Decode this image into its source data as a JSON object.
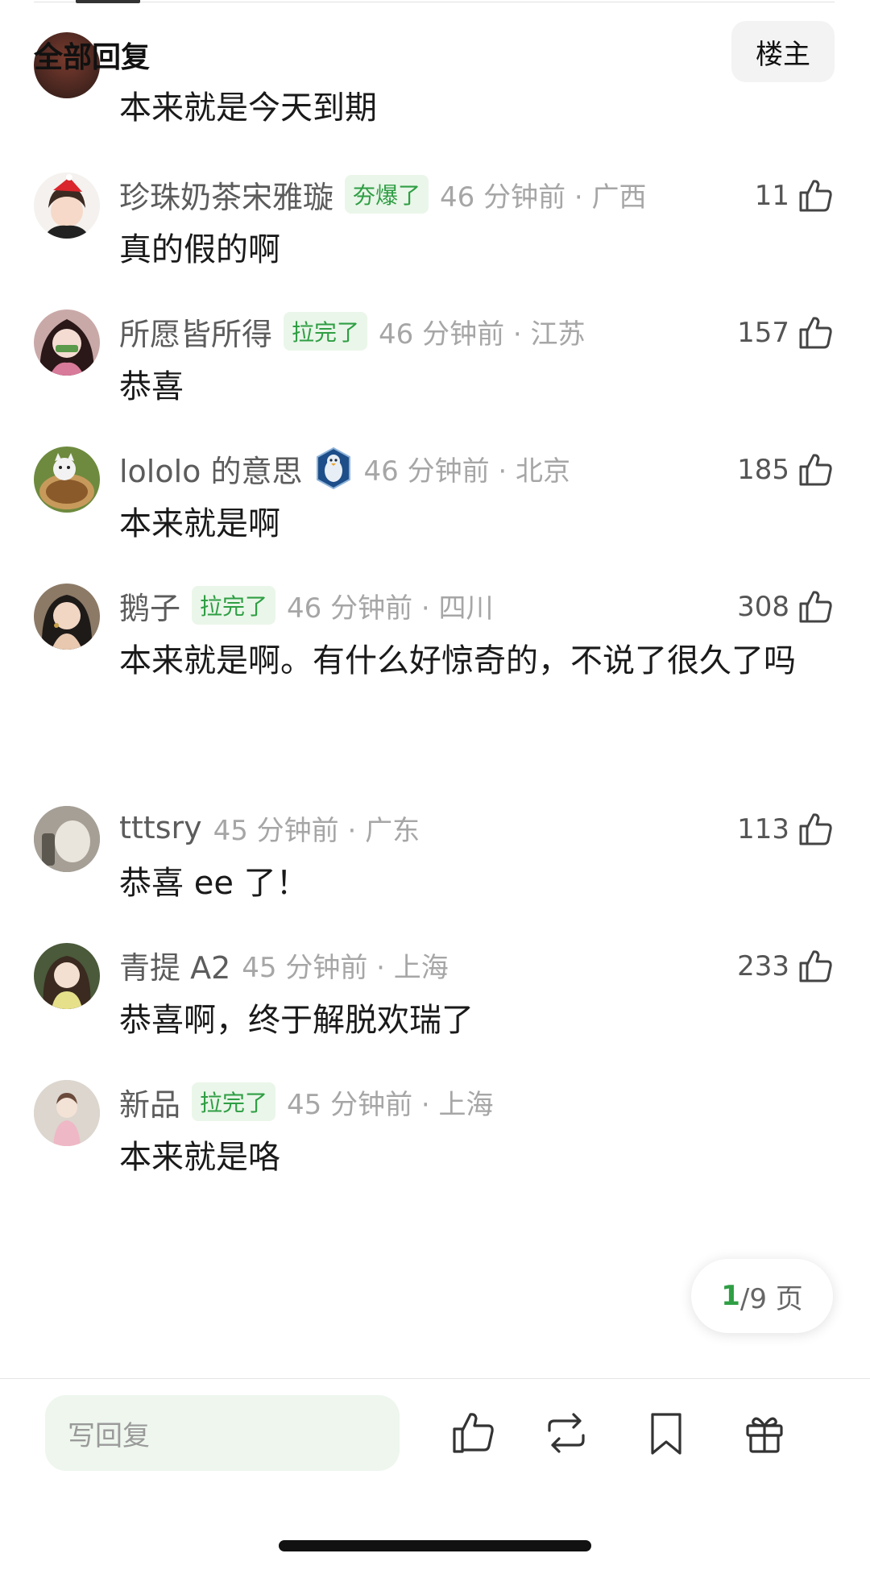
{
  "header": {
    "title": "全部回复",
    "op_filter_label": "楼主"
  },
  "comments": [
    {
      "content": "本来就是今天到期"
    },
    {
      "nick": "珍珠奶茶宋雅璇",
      "badge": "夯爆了",
      "time": "46 分钟前 · 广西",
      "likes": "11",
      "content": "真的假的啊"
    },
    {
      "nick": "所愿皆所得",
      "badge": "拉完了",
      "time": "46 分钟前 · 江苏",
      "likes": "157",
      "content": "恭喜"
    },
    {
      "nick": "lololo 的意思",
      "time": "46 分钟前 · 北京",
      "likes": "185",
      "content": "本来就是啊"
    },
    {
      "nick": "鹅子",
      "badge": "拉完了",
      "time": "46 分钟前 · 四川",
      "likes": "308",
      "content": "本来就是啊。有什么好惊奇的，不说了很久了吗"
    },
    {
      "nick": "tttsry",
      "time": "45 分钟前 · 广东",
      "likes": "113",
      "content": "恭喜 ee 了！"
    },
    {
      "nick": "青提 A2",
      "time": "45 分钟前 · 上海",
      "likes": "233",
      "content": "恭喜啊，终于解脱欢瑞了"
    },
    {
      "nick": "新品",
      "badge": "拉完了",
      "time": "45 分钟前 · 上海",
      "content": "本来就是咯"
    }
  ],
  "pagination": {
    "current": "1",
    "total_label": "/9 页"
  },
  "bottom_bar": {
    "reply_placeholder": "写回复"
  },
  "colors": {
    "accent_green": "#2f9e44",
    "badge_bg": "#eaf6e9",
    "input_bg": "#eef6ee"
  },
  "icons": [
    "thumb-up-icon",
    "repost-icon",
    "bookmark-icon",
    "gift-icon",
    "penguin-medal-icon"
  ]
}
